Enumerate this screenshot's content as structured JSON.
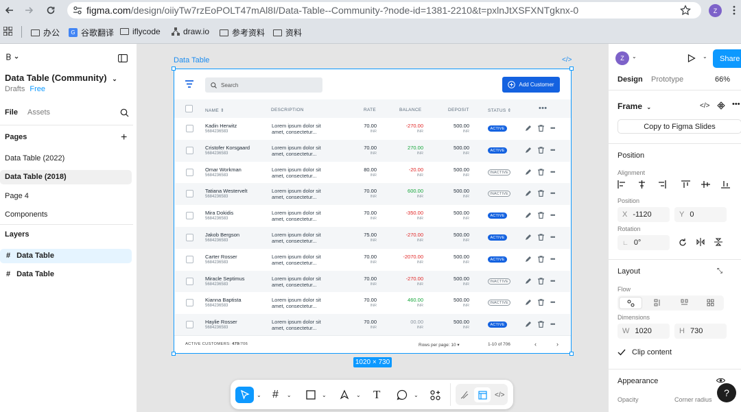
{
  "browser": {
    "url_domain": "figma.com",
    "url_path": "/design/oiiyTw7rzEoPOLT47mAl8I/Data-Table--Community-?node-id=1381-2210&t=pxlnJtXSFXNTgknx-0",
    "profile_initial": "Z",
    "bookmarks": [
      "办公",
      "谷歌翻译",
      "iflycode",
      "draw.io",
      "参考资料",
      "资料"
    ]
  },
  "left_panel": {
    "file_title": "Data Table (Community)",
    "drafts": "Drafts",
    "plan": "Free",
    "tab_file": "File",
    "tab_assets": "Assets",
    "pages_heading": "Pages",
    "pages": [
      "Data Table (2022)",
      "Data Table (2018)",
      "Page 4",
      "Components"
    ],
    "layers_heading": "Layers",
    "layers": [
      "Data Table",
      "Data Table"
    ]
  },
  "canvas": {
    "frame_label": "Data Table",
    "size_badge": "1020 × 730"
  },
  "table": {
    "search_placeholder": "Search",
    "add_button": "Add Customer",
    "headers": {
      "name": "NAME",
      "description": "DESCRIPTION",
      "rate": "RATE",
      "balance": "BALANCE",
      "deposit": "DEPOSIT",
      "status": "STATUS"
    },
    "rows": [
      {
        "name": "Kadin Herwitz",
        "id": "5684236583",
        "desc1": "Lorem ipsum dolor sit",
        "desc2": "amet, consectetur...",
        "rate": "70.00",
        "rate_cur": "INR",
        "balance": "-270.00",
        "bal_cur": "INR",
        "deposit": "500.00",
        "dep_cur": "INR",
        "status": "ACTIVE"
      },
      {
        "name": "Cristofer Korsgaard",
        "id": "5684236583",
        "desc1": "Lorem ipsum dolor sit",
        "desc2": "amet, consectetur...",
        "rate": "70.00",
        "rate_cur": "INR",
        "balance": "270.00",
        "bal_cur": "INR",
        "deposit": "500.00",
        "dep_cur": "INR",
        "status": "ACTIVE"
      },
      {
        "name": "Omar Workman",
        "id": "5684236583",
        "desc1": "Lorem ipsum dolor sit",
        "desc2": "amet, consectetur...",
        "rate": "80.00",
        "rate_cur": "INR",
        "balance": "-20.00",
        "bal_cur": "INR",
        "deposit": "500.00",
        "dep_cur": "INR",
        "status": "INACTIVE"
      },
      {
        "name": "Tatiana Westervelt",
        "id": "5684236583",
        "desc1": "Lorem ipsum dolor sit",
        "desc2": "amet, consectetur...",
        "rate": "70.00",
        "rate_cur": "INR",
        "balance": "600.00",
        "bal_cur": "INR",
        "deposit": "500.00",
        "dep_cur": "INR",
        "status": "INACTIVE"
      },
      {
        "name": "Mira Dokidis",
        "id": "5684236583",
        "desc1": "Lorem ipsum dolor sit",
        "desc2": "amet, consectetur...",
        "rate": "70.00",
        "rate_cur": "INR",
        "balance": "-350.00",
        "bal_cur": "INR",
        "deposit": "500.00",
        "dep_cur": "INR",
        "status": "ACTIVE"
      },
      {
        "name": "Jakob Bergson",
        "id": "5684236583",
        "desc1": "Lorem ipsum dolor sit",
        "desc2": "amet, consectetur...",
        "rate": "75.00",
        "rate_cur": "INR",
        "balance": "-270.00",
        "bal_cur": "INR",
        "deposit": "500.00",
        "dep_cur": "INR",
        "status": "ACTIVE"
      },
      {
        "name": "Carter Rosser",
        "id": "5684236583",
        "desc1": "Lorem ipsum dolor sit",
        "desc2": "amet, consectetur...",
        "rate": "70.00",
        "rate_cur": "INR",
        "balance": "-2070.00",
        "bal_cur": "INR",
        "deposit": "500.00",
        "dep_cur": "INR",
        "status": "ACTIVE"
      },
      {
        "name": "Miracle Septimus",
        "id": "5684236583",
        "desc1": "Lorem ipsum dolor sit",
        "desc2": "amet, consectetur...",
        "rate": "70.00",
        "rate_cur": "INR",
        "balance": "-270.00",
        "bal_cur": "INR",
        "deposit": "500.00",
        "dep_cur": "INR",
        "status": "INACTIVE"
      },
      {
        "name": "Kianna Baptista",
        "id": "5684236583",
        "desc1": "Lorem ipsum dolor sit",
        "desc2": "amet, consectetur...",
        "rate": "70.00",
        "rate_cur": "INR",
        "balance": "460.00",
        "bal_cur": "INR",
        "deposit": "500.00",
        "dep_cur": "INR",
        "status": "INACTIVE"
      },
      {
        "name": "Haylie Rosser",
        "id": "5684236583",
        "desc1": "Lorem ipsum dolor sit",
        "desc2": "amet, consectetur...",
        "rate": "70.00",
        "rate_cur": "INR",
        "balance": "00.00",
        "bal_cur": "INR",
        "deposit": "500.00",
        "dep_cur": "INR",
        "status": "ACTIVE"
      }
    ],
    "footer_active_label": "ACTIVE CUSTOMERS:",
    "footer_active_count": "479",
    "footer_active_total": "/706",
    "rows_per_page_label": "Rows per page:",
    "rows_per_page_value": "10",
    "range": "1-10 of 706"
  },
  "right_panel": {
    "avatar_initial": "Z",
    "share_button": "Share",
    "tab_design": "Design",
    "tab_prototype": "Prototype",
    "zoom": "66%",
    "frame_label": "Frame",
    "copy_slides": "Copy to Figma Slides",
    "position_heading": "Position",
    "alignment_label": "Alignment",
    "position_label": "Position",
    "x_key": "X",
    "x_value": "-1120",
    "y_key": "Y",
    "y_value": "0",
    "rotation_label": "Rotation",
    "rotation_value": "0°",
    "layout_heading": "Layout",
    "flow_label": "Flow",
    "dimensions_label": "Dimensions",
    "w_key": "W",
    "w_value": "1020",
    "h_key": "H",
    "h_value": "730",
    "clip_content": "Clip content",
    "appearance_heading": "Appearance",
    "opacity_label": "Opacity",
    "corner_radius_label": "Corner radius",
    "help": "?"
  },
  "colors": {
    "accent": "#0d99ff",
    "table_blue": "#1462e0",
    "negative": "#e02424",
    "positive": "#13a538"
  }
}
